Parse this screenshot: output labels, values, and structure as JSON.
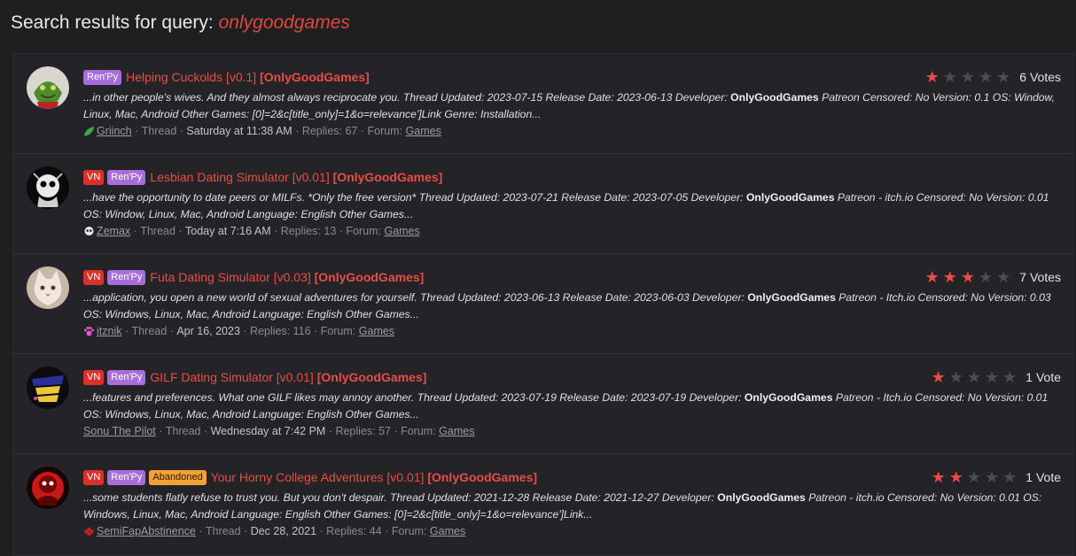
{
  "header": {
    "title_prefix": "Search results for query: ",
    "query": "onlygoodgames"
  },
  "colors": {
    "accent": "#e84d44",
    "renpy": "#a66ddb",
    "vn": "#d9322b",
    "abandoned": "#f0a13a"
  },
  "results": [
    {
      "tags": [
        "Ren'Py"
      ],
      "title": "Helping Cuckolds [v0.1] ",
      "dev": "[OnlyGoodGames]",
      "snippet_a": "...in other people's wives. And they almost always reciprocate you. Thread Updated: 2023-07-15 Release Date: 2023-06-13 Developer: ",
      "snippet_bold": "OnlyGoodGames",
      "snippet_b": " Patreon Censored: No Version: 0.1 OS: Window, Linux, Mac, Android Other Games: [0]=2&c[title_only]=1&o=relevance']Link Genre: Installation...",
      "user": "Griinch",
      "type": "Thread",
      "date": "Saturday at 11:38 AM",
      "replies": "Replies: 67",
      "forum_label": "Forum:",
      "forum": "Games",
      "stars": 1,
      "votes": "6 Votes",
      "user_icon": "leaf-icon"
    },
    {
      "tags": [
        "VN",
        "Ren'Py"
      ],
      "title": "Lesbian Dating Simulator [v0.01] ",
      "dev": "[OnlyGoodGames]",
      "snippet_a": "...have the opportunity to date peers or MILFs. *Only the free version* Thread Updated: 2023-07-21 Release Date: 2023-07-05 Developer: ",
      "snippet_bold": "OnlyGoodGames",
      "snippet_b": " Patreon - itch.io Censored: No Version: 0.01 OS: Window, Linux, Mac, Android Language: English Other Games...",
      "user": "Zemax",
      "type": "Thread",
      "date": "Today at 7:16 AM",
      "replies": "Replies: 13",
      "forum_label": "Forum:",
      "forum": "Games",
      "stars": 0,
      "votes": "",
      "user_icon": "skull-icon"
    },
    {
      "tags": [
        "VN",
        "Ren'Py"
      ],
      "title": "Futa Dating Simulator [v0.03] ",
      "dev": "[OnlyGoodGames]",
      "snippet_a": "...application, you open a new world of sexual adventures for yourself. Thread Updated: 2023-06-13 Release Date: 2023-06-03 Developer: ",
      "snippet_bold": "OnlyGoodGames",
      "snippet_b": " Patreon - Itch.io Censored: No Version: 0.03 OS: Windows, Linux, Mac, Android Language: English Other Games...",
      "user": "itznik",
      "type": "Thread",
      "date": "Apr 16, 2023",
      "replies": "Replies: 116",
      "forum_label": "Forum:",
      "forum": "Games",
      "stars": 3,
      "votes": "7 Votes",
      "user_icon": "paw-icon"
    },
    {
      "tags": [
        "VN",
        "Ren'Py"
      ],
      "title": "GILF Dating Simulator [v0.01] ",
      "dev": "[OnlyGoodGames]",
      "snippet_a": "...features and preferences. What one GILF likes may annoy another. Thread Updated: 2023-07-19 Release Date: 2023-07-19 Developer: ",
      "snippet_bold": "OnlyGoodGames",
      "snippet_b": " Patreon - Itch.io Censored: No Version: 0.01 OS: Windows, Linux, Mac, Android Language: English Other Games...",
      "user": "Sonu The Pilot",
      "type": "Thread",
      "date": "Wednesday at 7:42 PM",
      "replies": "Replies: 57",
      "forum_label": "Forum:",
      "forum": "Games",
      "stars": 1,
      "votes": "1 Vote",
      "user_icon": ""
    },
    {
      "tags": [
        "VN",
        "Ren'Py",
        "Abandoned"
      ],
      "title": "Your Horny College Adventures [v0.01] ",
      "dev": "[OnlyGoodGames]",
      "snippet_a": "...some students flatly refuse to trust you. But you don't despair. Thread Updated: 2021-12-28 Release Date: 2021-12-27 Developer: ",
      "snippet_bold": "OnlyGoodGames",
      "snippet_b": " Patreon - itch.io Censored: No Version: 0.01 OS: Windows, Linux, Mac, Android Language: English Other Games: [0]=2&c[title_only]=1&o=relevance']Link...",
      "user": "SemiFapAbstinence",
      "type": "Thread",
      "date": "Dec 28, 2021",
      "replies": "Replies: 44",
      "forum_label": "Forum:",
      "forum": "Games",
      "stars": 2,
      "votes": "1 Vote",
      "user_icon": "flower-icon"
    }
  ]
}
